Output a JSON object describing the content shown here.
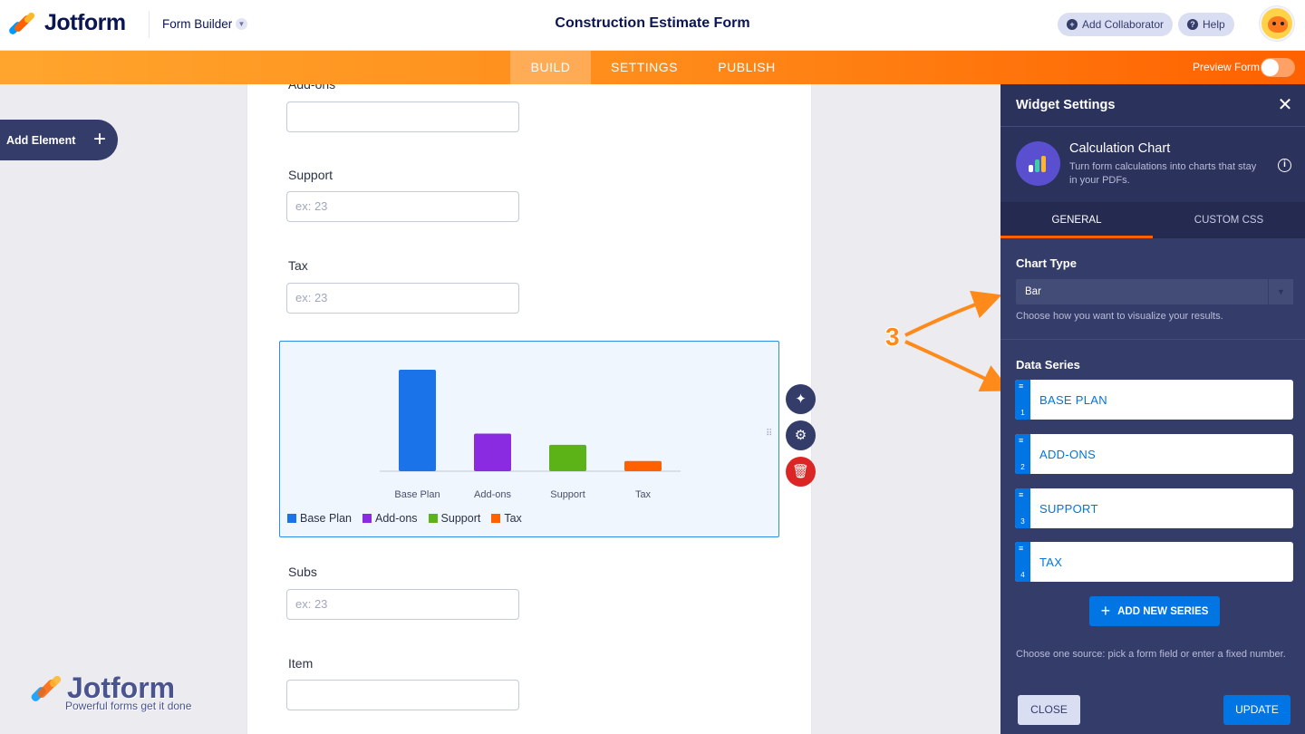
{
  "header": {
    "brand": "Jotform",
    "builder_label": "Form Builder",
    "form_title": "Construction Estimate Form",
    "add_collaborator": "Add Collaborator",
    "help": "Help"
  },
  "nav": {
    "tabs": [
      "BUILD",
      "SETTINGS",
      "PUBLISH"
    ],
    "active_tab": "BUILD",
    "preview_label": "Preview Form",
    "preview_on": false
  },
  "sidebar": {
    "add_element": "Add Element"
  },
  "form": {
    "fields": [
      {
        "label": "Add-ons",
        "placeholder": ""
      },
      {
        "label": "Support",
        "placeholder": "ex: 23"
      },
      {
        "label": "Tax",
        "placeholder": "ex: 23"
      },
      {
        "label": "Subs",
        "placeholder": "ex: 23"
      },
      {
        "label": "Item",
        "placeholder": ""
      }
    ]
  },
  "chart_data": {
    "type": "bar",
    "categories": [
      "Base Plan",
      "Add-ons",
      "Support",
      "Tax"
    ],
    "values": [
      100,
      37,
      26,
      10
    ],
    "colors": [
      "#1a73e8",
      "#8a2be2",
      "#5bb318",
      "#ff6100"
    ],
    "legend": [
      "Base Plan",
      "Add-ons",
      "Support",
      "Tax"
    ],
    "legend_position": "bottom-left",
    "grid": false
  },
  "watermark": {
    "brand": "Jotform",
    "tagline": "Powerful forms get it done"
  },
  "annotation": {
    "number": "3",
    "color": "#ff8a1c"
  },
  "panel": {
    "title": "Widget Settings",
    "widget_name": "Calculation Chart",
    "widget_desc": "Turn form calculations into charts that stay in your PDFs.",
    "tabs": [
      "GENERAL",
      "CUSTOM CSS"
    ],
    "active_tab": "GENERAL",
    "chart_type_title": "Chart Type",
    "chart_type_value": "Bar",
    "chart_type_help": "Choose how you want to visualize your results.",
    "data_series_title": "Data Series",
    "series": [
      {
        "index": "1",
        "label": "BASE PLAN"
      },
      {
        "index": "2",
        "label": "ADD-ONS"
      },
      {
        "index": "3",
        "label": "SUPPORT"
      },
      {
        "index": "4",
        "label": "TAX"
      }
    ],
    "add_series": "ADD NEW SERIES",
    "source_help": "Choose one source: pick a form field or enter a fixed number.",
    "close": "CLOSE",
    "update": "UPDATE"
  },
  "colors": {
    "brand_orange": "#ff6100",
    "primary_blue": "#0075e3",
    "panel_bg": "#343c6a"
  }
}
